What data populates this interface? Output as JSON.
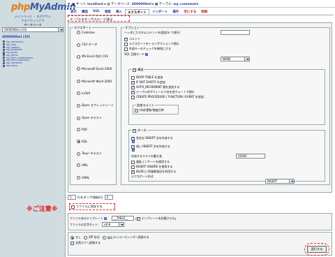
{
  "sidebar": {
    "logo_main": "php",
    "logo_brand": "MyAdmin",
    "links": [
      "メインページ ・ ログアウト",
      "クエリウィンドウ"
    ],
    "db_label": "データベース",
    "db_selected": "4000008ml (10)",
    "db_name": "4000008ml (10)",
    "tables": [
      "wp_comments",
      "wp_links",
      "wp_options",
      "wp_postmeta",
      "wp_posts",
      "wp_terms",
      "wp_term_relationships",
      "wp_term_taxonomy",
      "wp_usermeta",
      "wp_users"
    ]
  },
  "header": {
    "server_label": "サーバ:",
    "server": "localhost",
    "db_label": "データベース:",
    "db": "4000008ml",
    "table_label": "テーブル:",
    "table": "wp_comments"
  },
  "tabs": [
    {
      "label": "表示",
      "kind": "link"
    },
    {
      "label": "構造",
      "kind": "link"
    },
    {
      "label": "SQL",
      "kind": "link"
    },
    {
      "label": "検索",
      "kind": "link"
    },
    {
      "label": "挿入",
      "kind": "link"
    },
    {
      "label": "エクスポート",
      "kind": "active"
    },
    {
      "label": "インポート",
      "kind": "link"
    },
    {
      "label": "操作",
      "kind": "link"
    },
    {
      "label": "空にする",
      "kind": "red"
    },
    {
      "label": "削除",
      "kind": "red"
    }
  ],
  "export_header": "テーブルのダンプ(スキーマ)表示",
  "export": {
    "legend": "エクスポート",
    "formats": [
      "CodeGen",
      "CSV データ",
      "MS Excel 用の CSV",
      "Microsoft Excel 2000",
      "Microsoft Word 2000",
      "LaTeX",
      "Open スプレッドシート",
      "Open テキスト",
      "PDF",
      "SQL",
      "Texy! テキスト",
      "XML",
      "YAML"
    ],
    "selected": "SQL"
  },
  "options": {
    "legend": "オプション",
    "header_comment_label": "ヘッダにカスタムコメントを追加(\\n で改行)",
    "header_comment_value": "",
    "comments": "コメント",
    "transaction": "エクスポートをトランザクションで囲む",
    "disable_fk": "外部キーのチェックを無効にする",
    "compat_label": "SQL 互換モード",
    "compat_value": "NONE",
    "structure": {
      "legend": "構造",
      "drop_table": "DROP TABLE を追加",
      "if_not_exists": "IF NOT EXISTS を追加",
      "auto_increment": "AUTO_INCREMENT 値を追加する",
      "backquotes": "テーブル名やフィールド名を逆クォートで囲む",
      "create_procedure": "CREATE PROCEDURE / FUNCTION / EVENT を追加",
      "add_comments_legend": "追加コメント",
      "creation_time": "作成/更新/検査日時"
    },
    "data": {
      "legend": "データ",
      "complete_insert": "完全な INSERT 文を作成する",
      "extended_insert": "長い INSERT 文を作成する",
      "max_query_label": "作成するクエリの最大長",
      "max_query_value": "50000",
      "delayed": "遅延インサートを使用する",
      "ignore": "INSERT IGNORE を使用する",
      "hex": "BLOB に16進数表記を利用する",
      "export_type_label": "エクスポート形式",
      "export_type_value": "INSERT"
    }
  },
  "rows": {
    "count": "1",
    "label": "行をダンプ(開始行)",
    "start": "0"
  },
  "annotation": "※ご注意※",
  "save_file": "ファイルに保存する",
  "file": {
    "template_label": "ファイル名のテンプレート",
    "template_value": "__TABLE__",
    "remember": "テンプレートを記憶させる",
    "charset_label": "ファイルの文字セット:",
    "charset_value": "utf-8"
  },
  "compression": {
    "options": [
      "なし",
      "ZIP 形式",
      "gzip 形式"
    ],
    "selected": "なし",
    "hex_label": "SJIS",
    "convert_label": "エンコーディングへ変換する",
    "zenkaku": "全角カナへ変換する"
  },
  "go_button": "実行する"
}
